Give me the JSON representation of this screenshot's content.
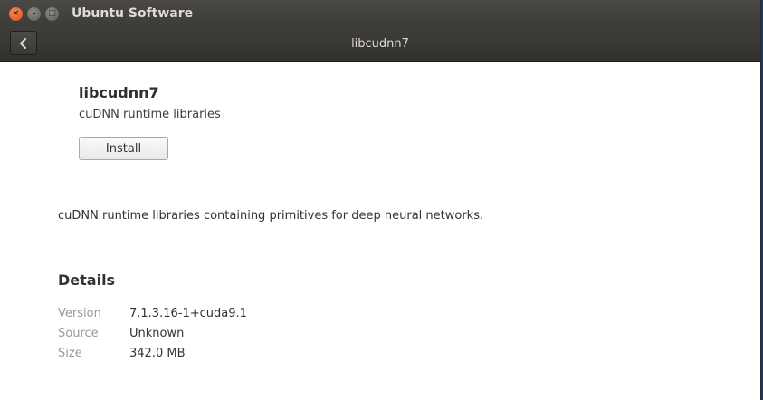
{
  "window": {
    "title": "Ubuntu Software",
    "close_glyph": "×",
    "minimize_glyph": "–",
    "maximize_glyph": "□"
  },
  "header": {
    "back_icon": "chevron-left-icon",
    "title": "libcudnn7"
  },
  "app": {
    "name": "libcudnn7",
    "summary": "cuDNN runtime libraries",
    "install_label": "Install",
    "description": "cuDNN runtime libraries containing primitives for deep neural networks."
  },
  "details": {
    "heading": "Details",
    "rows": [
      {
        "label": "Version",
        "value": "7.1.3.16-1+cuda9.1"
      },
      {
        "label": "Source",
        "value": "Unknown"
      },
      {
        "label": "Size",
        "value": "342.0 MB"
      }
    ]
  },
  "colors": {
    "close_button": "#df4a16",
    "titlebar": "#3c3b37",
    "headerbar": "#32312d",
    "desktop": "#1b3a63"
  }
}
